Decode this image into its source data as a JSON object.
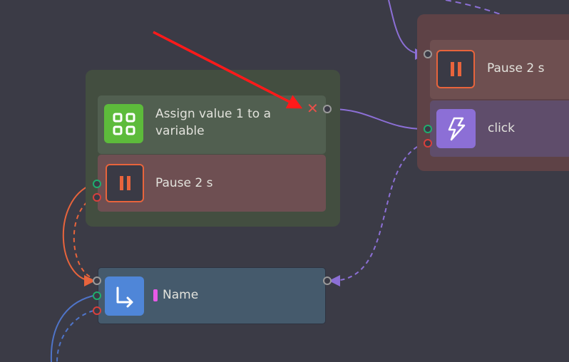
{
  "nodes": {
    "assign": {
      "label": "Assign value 1 to a variable",
      "icon": "grid-icon"
    },
    "pause_left": {
      "label": "Pause 2 s",
      "icon": "pause-icon"
    },
    "pause_right": {
      "label": "Pause 2 s",
      "icon": "pause-icon"
    },
    "click": {
      "label": "click",
      "icon": "lightning-icon"
    },
    "name": {
      "label": "Name",
      "icon": "arrow-return-icon"
    }
  },
  "colors": {
    "background": "#3b3b46",
    "accent_purple": "#8c6fd6",
    "accent_orange": "#e8643c",
    "accent_green": "#5dbb3b",
    "accent_blue": "#4f86d8",
    "delete": "#e8504a",
    "annotation_arrow": "#ff1a1a"
  }
}
